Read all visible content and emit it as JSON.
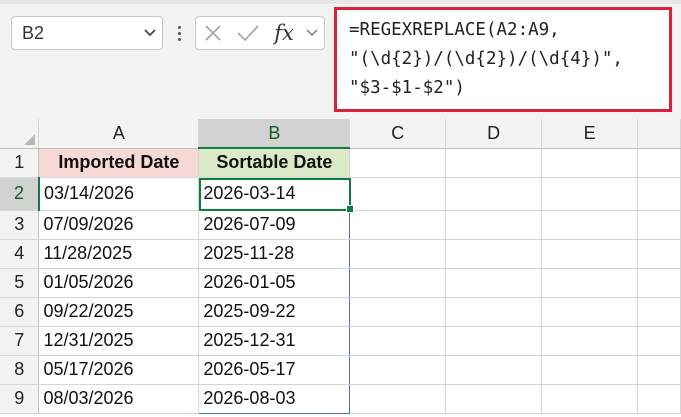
{
  "name_box": {
    "value": "B2"
  },
  "formula_bar": {
    "fx_label": "fx",
    "formula_lines": [
      "=REGEXREPLACE(A2:A9,",
      "\"(\\d{2})/(\\d{2})/(\\d{4})\",",
      "\"$3-$1-$2\")"
    ]
  },
  "columns": [
    "A",
    "B",
    "C",
    "D",
    "E"
  ],
  "rows": [
    "1",
    "2",
    "3",
    "4",
    "5",
    "6",
    "7",
    "8",
    "9"
  ],
  "headers": {
    "a": "Imported Date",
    "b": "Sortable Date"
  },
  "data_rows": [
    {
      "a": "03/14/2026",
      "b": "2026-03-14"
    },
    {
      "a": "07/09/2026",
      "b": "2026-07-09"
    },
    {
      "a": "11/28/2025",
      "b": "2025-11-28"
    },
    {
      "a": "01/05/2026",
      "b": "2026-01-05"
    },
    {
      "a": "09/22/2025",
      "b": "2025-09-22"
    },
    {
      "a": "12/31/2025",
      "b": "2025-12-31"
    },
    {
      "a": "05/17/2026",
      "b": "2026-05-17"
    },
    {
      "a": "08/03/2026",
      "b": "2026-08-03"
    }
  ],
  "colors": {
    "selection_green": "#107c41",
    "formula_highlight": "#d6243a",
    "spill_border": "#4472c4",
    "header_a_fill": "#f8d9d6",
    "header_b_fill": "#daeac9"
  }
}
